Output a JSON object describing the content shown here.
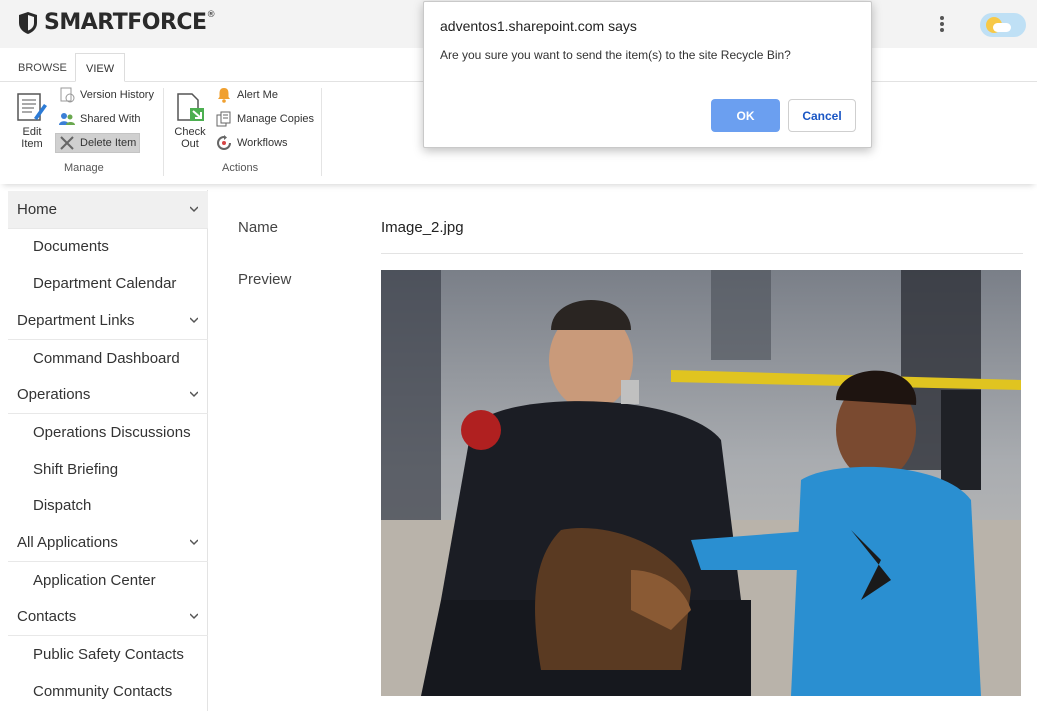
{
  "header": {
    "logo_text": "SMARTFORCE",
    "logo_mark": "®"
  },
  "ribbon": {
    "tabs": [
      {
        "label": "BROWSE"
      },
      {
        "label": "VIEW"
      }
    ],
    "manage": {
      "edit_item_line1": "Edit",
      "edit_item_line2": "Item",
      "version_history": "Version History",
      "shared_with": "Shared With",
      "delete_item": "Delete Item",
      "group_label": "Manage"
    },
    "actions": {
      "check_out_line1": "Check",
      "check_out_line2": "Out",
      "alert_me": "Alert Me",
      "manage_copies": "Manage Copies",
      "workflows": "Workflows",
      "group_label": "Actions"
    }
  },
  "sidebar": {
    "items": [
      {
        "label": "Home",
        "type": "parent",
        "active": true
      },
      {
        "label": "Documents",
        "type": "child"
      },
      {
        "label": "Department Calendar",
        "type": "child"
      },
      {
        "label": "Department Links",
        "type": "parent"
      },
      {
        "label": "Command Dashboard",
        "type": "child"
      },
      {
        "label": "Operations",
        "type": "parent"
      },
      {
        "label": "Operations Discussions",
        "type": "child"
      },
      {
        "label": "Shift Briefing",
        "type": "child"
      },
      {
        "label": "Dispatch",
        "type": "child"
      },
      {
        "label": "All Applications",
        "type": "parent"
      },
      {
        "label": "Application Center",
        "type": "child"
      },
      {
        "label": "Contacts",
        "type": "parent"
      },
      {
        "label": "Public Safety Contacts",
        "type": "child"
      },
      {
        "label": "Community Contacts",
        "type": "child"
      }
    ]
  },
  "content": {
    "name_label": "Name",
    "name_value": "Image_2.jpg",
    "preview_label": "Preview"
  },
  "dialog": {
    "title": "adventos1.sharepoint.com says",
    "message": "Are you sure you want to send the item(s) to the site Recycle Bin?",
    "ok_label": "OK",
    "cancel_label": "Cancel"
  },
  "colors": {
    "ok_button": "#6b9ff0",
    "cancel_text": "#1a56c4",
    "topbar": "#f3f3f3"
  }
}
